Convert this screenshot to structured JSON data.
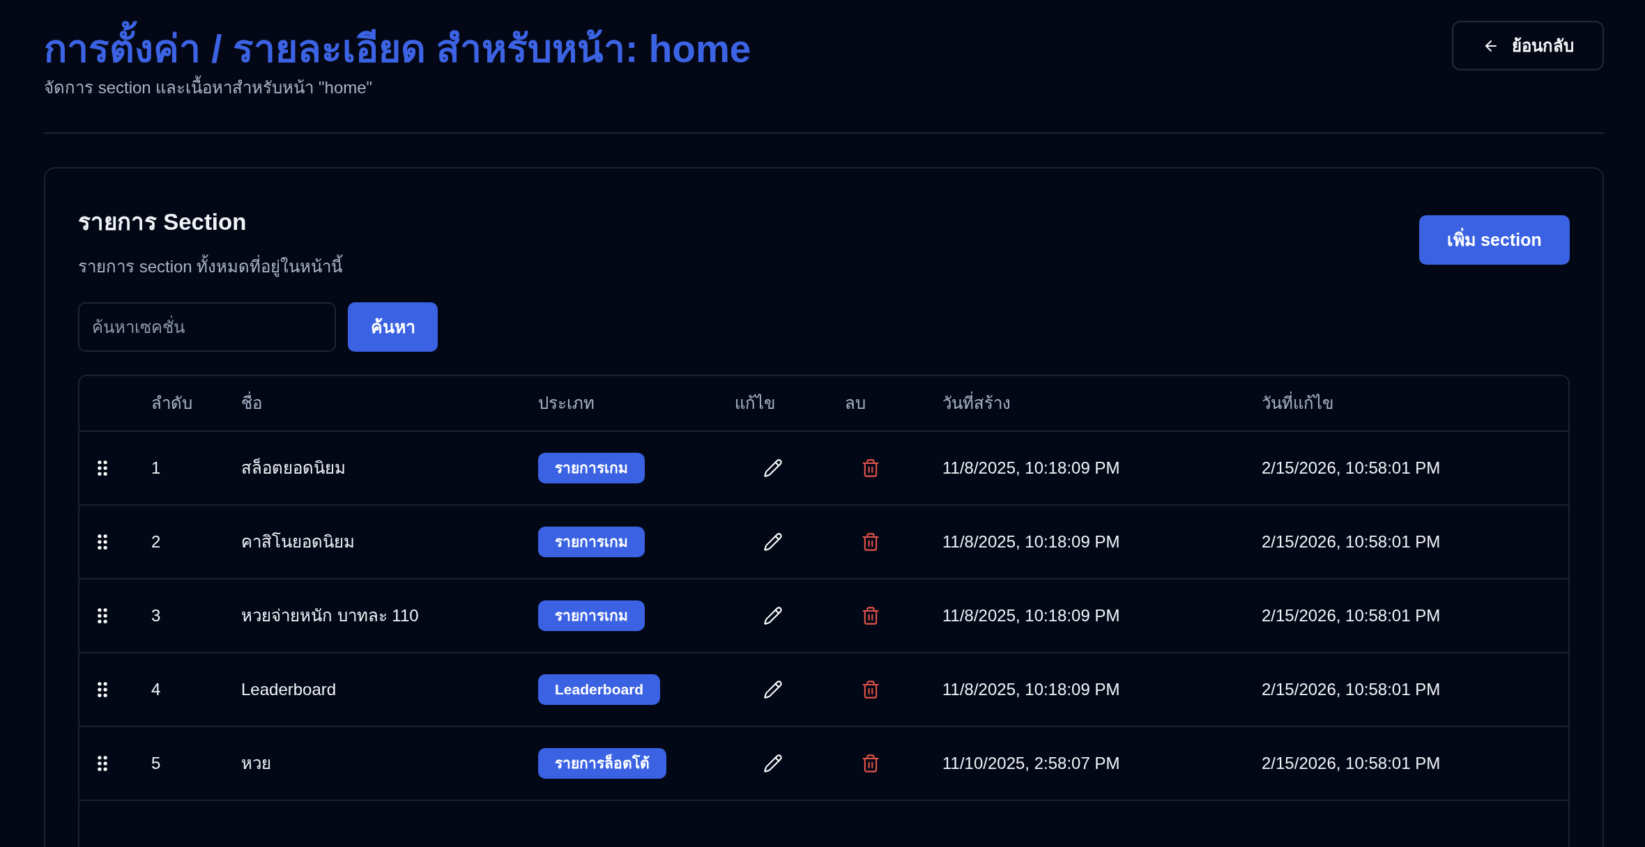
{
  "page": {
    "title": "การตั้งค่า / รายละเอียด สำหรับหน้า: home",
    "subtitle": "จัดการ section และเนื้อหาสำหรับหน้า \"home\""
  },
  "back_button": {
    "label": "ย้อนกลับ"
  },
  "section_card": {
    "title": "รายการ Section",
    "description": "รายการ section ทั้งหมดที่อยู่ในหน้านี้",
    "add_button": "เพิ่ม section",
    "search": {
      "placeholder": "ค้นหาเซคชั่น",
      "button": "ค้นหา"
    }
  },
  "table": {
    "columns": [
      "ลำดับ",
      "ชื่อ",
      "ประเภท",
      "แก้ไข",
      "ลบ",
      "วันที่สร้าง",
      "วันที่แก้ไข"
    ],
    "rows": [
      {
        "order": "1",
        "name": "สล็อตยอดนิยม",
        "type": "รายการเกม",
        "created": "11/8/2025, 10:18:09 PM",
        "updated": "2/15/2026, 10:58:01 PM"
      },
      {
        "order": "2",
        "name": "คาสิโนยอดนิยม",
        "type": "รายการเกม",
        "created": "11/8/2025, 10:18:09 PM",
        "updated": "2/15/2026, 10:58:01 PM"
      },
      {
        "order": "3",
        "name": "หวยจ่ายหนัก บาทละ 110",
        "type": "รายการเกม",
        "created": "11/8/2025, 10:18:09 PM",
        "updated": "2/15/2026, 10:58:01 PM"
      },
      {
        "order": "4",
        "name": "Leaderboard",
        "type": "Leaderboard",
        "created": "11/8/2025, 10:18:09 PM",
        "updated": "2/15/2026, 10:58:01 PM"
      },
      {
        "order": "5",
        "name": "หวย",
        "type": "รายการล็อตโต้",
        "created": "11/10/2025, 2:58:07 PM",
        "updated": "2/15/2026, 10:58:01 PM"
      }
    ]
  }
}
